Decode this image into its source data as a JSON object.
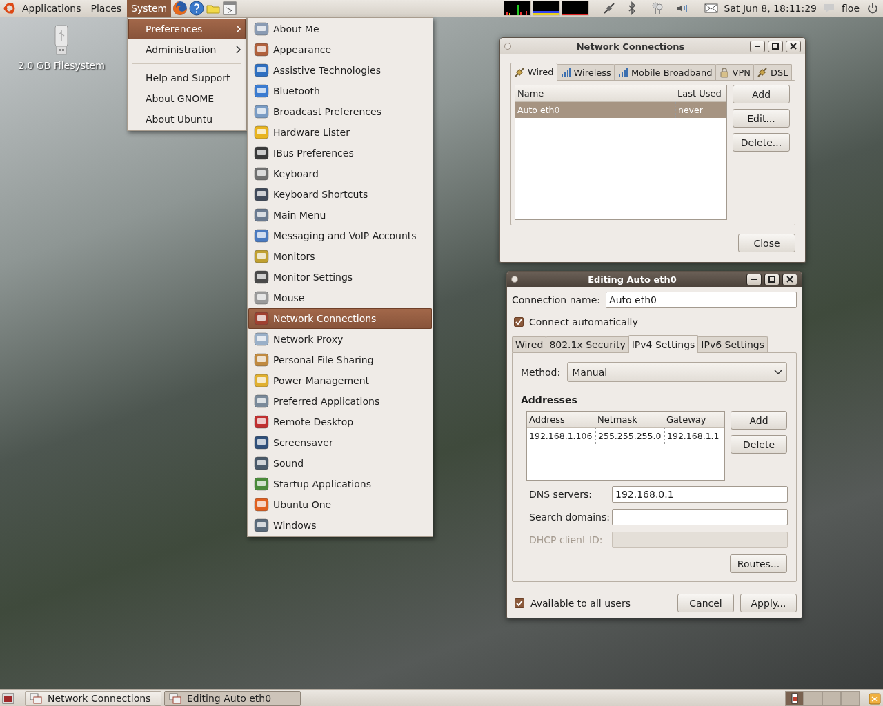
{
  "top_panel": {
    "menus": [
      {
        "label": "Applications",
        "selected": false
      },
      {
        "label": "Places",
        "selected": false
      },
      {
        "label": "System",
        "selected": true
      }
    ],
    "clock": "Sat Jun  8, 18:11:29",
    "user": "floe"
  },
  "desktop_icons": [
    {
      "label": "2.0 GB Filesystem"
    }
  ],
  "system_menu": {
    "sections": [
      [
        {
          "label": "Preferences",
          "submenu": true,
          "selected": true
        },
        {
          "label": "Administration",
          "submenu": true,
          "selected": false
        }
      ],
      [
        {
          "label": "Help and Support",
          "submenu": false,
          "selected": false
        },
        {
          "label": "About GNOME",
          "submenu": false,
          "selected": false
        },
        {
          "label": "About Ubuntu",
          "submenu": false,
          "selected": false
        }
      ]
    ]
  },
  "preferences_menu": {
    "items": [
      {
        "label": "About Me",
        "selected": false
      },
      {
        "label": "Appearance",
        "selected": false
      },
      {
        "label": "Assistive Technologies",
        "selected": false
      },
      {
        "label": "Bluetooth",
        "selected": false
      },
      {
        "label": "Broadcast Preferences",
        "selected": false
      },
      {
        "label": "Hardware Lister",
        "selected": false
      },
      {
        "label": "IBus Preferences",
        "selected": false
      },
      {
        "label": "Keyboard",
        "selected": false
      },
      {
        "label": "Keyboard Shortcuts",
        "selected": false
      },
      {
        "label": "Main Menu",
        "selected": false
      },
      {
        "label": "Messaging and VoIP Accounts",
        "selected": false
      },
      {
        "label": "Monitors",
        "selected": false
      },
      {
        "label": "Monitor Settings",
        "selected": false
      },
      {
        "label": "Mouse",
        "selected": false
      },
      {
        "label": "Network Connections",
        "selected": true
      },
      {
        "label": "Network Proxy",
        "selected": false
      },
      {
        "label": "Personal File Sharing",
        "selected": false
      },
      {
        "label": "Power Management",
        "selected": false
      },
      {
        "label": "Preferred Applications",
        "selected": false
      },
      {
        "label": "Remote Desktop",
        "selected": false
      },
      {
        "label": "Screensaver",
        "selected": false
      },
      {
        "label": "Sound",
        "selected": false
      },
      {
        "label": "Startup Applications",
        "selected": false
      },
      {
        "label": "Ubuntu One",
        "selected": false
      },
      {
        "label": "Windows",
        "selected": false
      }
    ]
  },
  "network_window": {
    "title": "Network Connections",
    "active": false,
    "tabs": [
      {
        "label": "Wired",
        "selected": true
      },
      {
        "label": "Wireless",
        "selected": false
      },
      {
        "label": "Mobile Broadband",
        "selected": false
      },
      {
        "label": "VPN",
        "selected": false
      },
      {
        "label": "DSL",
        "selected": false
      }
    ],
    "table": {
      "columns": [
        "Name",
        "Last Used"
      ],
      "rows": [
        {
          "cells": [
            "Auto eth0",
            "never"
          ],
          "selected": true
        }
      ]
    },
    "buttons": [
      "Add",
      "Edit...",
      "Delete..."
    ],
    "close_button": "Close"
  },
  "editing_window": {
    "title": "Editing Auto eth0",
    "active": true,
    "connection_name": {
      "label": "Connection name:",
      "value": "Auto eth0"
    },
    "connect_automatically": {
      "label": "Connect automatically",
      "checked": true
    },
    "tabs": [
      {
        "label": "Wired",
        "selected": false
      },
      {
        "label": "802.1x Security",
        "selected": false
      },
      {
        "label": "IPv4 Settings",
        "selected": true
      },
      {
        "label": "IPv6 Settings",
        "selected": false
      }
    ],
    "method": {
      "label": "Method:",
      "value": "Manual"
    },
    "addresses": {
      "heading": "Addresses",
      "columns": [
        "Address",
        "Netmask",
        "Gateway"
      ],
      "rows": [
        {
          "cells": [
            "192.168.1.106",
            "255.255.255.0",
            "192.168.1.1"
          ],
          "selected": false
        }
      ],
      "buttons": [
        "Add",
        "Delete"
      ]
    },
    "fields": [
      {
        "label": "DNS servers:",
        "value": "192.168.0.1",
        "disabled": false
      },
      {
        "label": "Search domains:",
        "disabled": false
      },
      {
        "label": "DHCP client ID:",
        "disabled": true
      }
    ],
    "routes_button": "Routes...",
    "available_to_all": {
      "label": "Available to all users",
      "checked": true
    },
    "buttons": [
      "Cancel",
      "Apply..."
    ]
  },
  "taskbar": {
    "windows": [
      {
        "label": "Network Connections",
        "selected": false
      },
      {
        "label": "Editing Auto eth0",
        "selected": true
      }
    ],
    "workspaces": [
      {
        "selected": true
      },
      {
        "selected": false
      },
      {
        "selected": false
      },
      {
        "selected": false
      }
    ]
  }
}
